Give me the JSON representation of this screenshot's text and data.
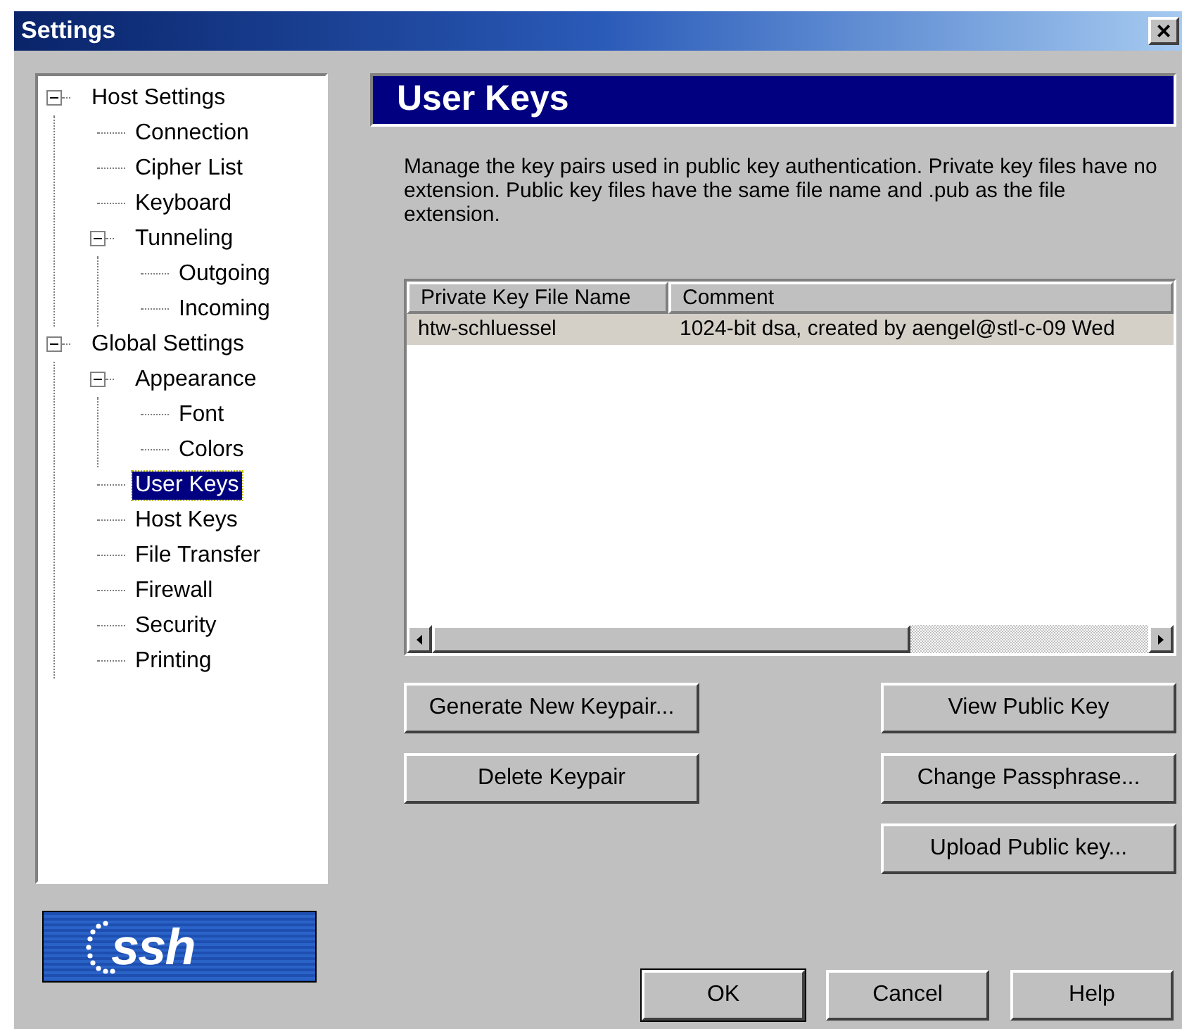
{
  "window": {
    "title": "Settings",
    "close": "×"
  },
  "tree": [
    {
      "label": "Host Settings",
      "expanded": true,
      "selected": false,
      "children": [
        {
          "label": "Connection",
          "selected": false
        },
        {
          "label": "Cipher List",
          "selected": false
        },
        {
          "label": "Keyboard",
          "selected": false
        },
        {
          "label": "Tunneling",
          "expanded": true,
          "selected": false,
          "children": [
            {
              "label": "Outgoing",
              "selected": false
            },
            {
              "label": "Incoming",
              "selected": false
            }
          ]
        }
      ]
    },
    {
      "label": "Global Settings",
      "expanded": true,
      "selected": false,
      "children": [
        {
          "label": "Appearance",
          "expanded": true,
          "selected": false,
          "children": [
            {
              "label": "Font",
              "selected": false
            },
            {
              "label": "Colors",
              "selected": false
            }
          ]
        },
        {
          "label": "User Keys",
          "selected": true
        },
        {
          "label": "Host Keys",
          "selected": false
        },
        {
          "label": "File Transfer",
          "selected": false
        },
        {
          "label": "Firewall",
          "selected": false
        },
        {
          "label": "Security",
          "selected": false
        },
        {
          "label": "Printing",
          "selected": false
        }
      ]
    }
  ],
  "logo": {
    "text": "ssh"
  },
  "page": {
    "title": "User Keys",
    "description": "Manage the key pairs used in public key authentication. Private key files have no extension. Public key files have the same file name and .pub as the file extension."
  },
  "table": {
    "columns": [
      "Private Key File Name",
      "Comment"
    ],
    "rows": [
      {
        "cells": [
          "htw-schluessel",
          "1024-bit dsa, created by aengel@stl-c-09 Wed"
        ],
        "selected": true
      }
    ]
  },
  "left_buttons": [
    "Generate New Keypair...",
    "Delete Keypair"
  ],
  "right_buttons": [
    "View Public Key",
    "Change Passphrase...",
    "Upload Public key..."
  ],
  "dialog_buttons": [
    {
      "label": "OK",
      "default": true
    },
    {
      "label": "Cancel",
      "default": false
    },
    {
      "label": "Help",
      "default": false
    }
  ]
}
